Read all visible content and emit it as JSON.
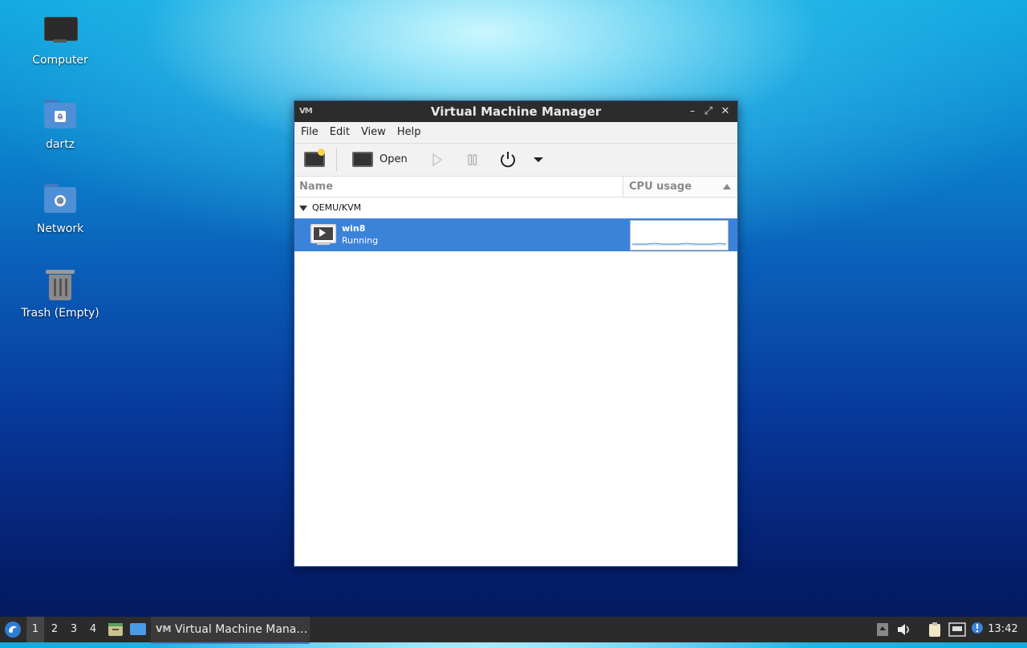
{
  "desktop": {
    "icons": [
      {
        "label": "Computer",
        "icon": "computer-icon"
      },
      {
        "label": "dartz",
        "icon": "home-folder-icon"
      },
      {
        "label": "Network",
        "icon": "network-folder-icon"
      },
      {
        "label": "Trash (Empty)",
        "icon": "trash-icon"
      }
    ]
  },
  "window": {
    "title": "Virtual Machine Manager",
    "app_logo": "VM",
    "controls": {
      "minimize": "–",
      "maximize": "⤢",
      "close": "✕"
    },
    "menu": [
      "File",
      "Edit",
      "View",
      "Help"
    ],
    "toolbar": {
      "new_vm_icon": "new-vm-icon",
      "open_label": "Open",
      "run_icon": "play-icon",
      "pause_icon": "pause-icon",
      "shutdown_icon": "power-icon",
      "dropdown_icon": "chevron-down-icon"
    },
    "columns": {
      "name": "Name",
      "cpu": "CPU usage",
      "sort": "ascending"
    },
    "connections": [
      {
        "label": "QEMU/KVM",
        "expanded": true,
        "vms": [
          {
            "name": "win8",
            "status": "Running",
            "selected": true
          }
        ]
      }
    ]
  },
  "taskbar": {
    "workspaces": [
      "1",
      "2",
      "3",
      "4"
    ],
    "active_workspace": "1",
    "task": "Virtual Machine Mana…",
    "clock": "13:42",
    "tray_icons": [
      "eject-icon",
      "volume-icon",
      "clipboard-icon",
      "network-icon",
      "update-notifier-icon"
    ]
  },
  "colors": {
    "selection": "#3b82d9",
    "titlebar": "#2c2c2c",
    "taskbar": "#2b2b2b"
  }
}
